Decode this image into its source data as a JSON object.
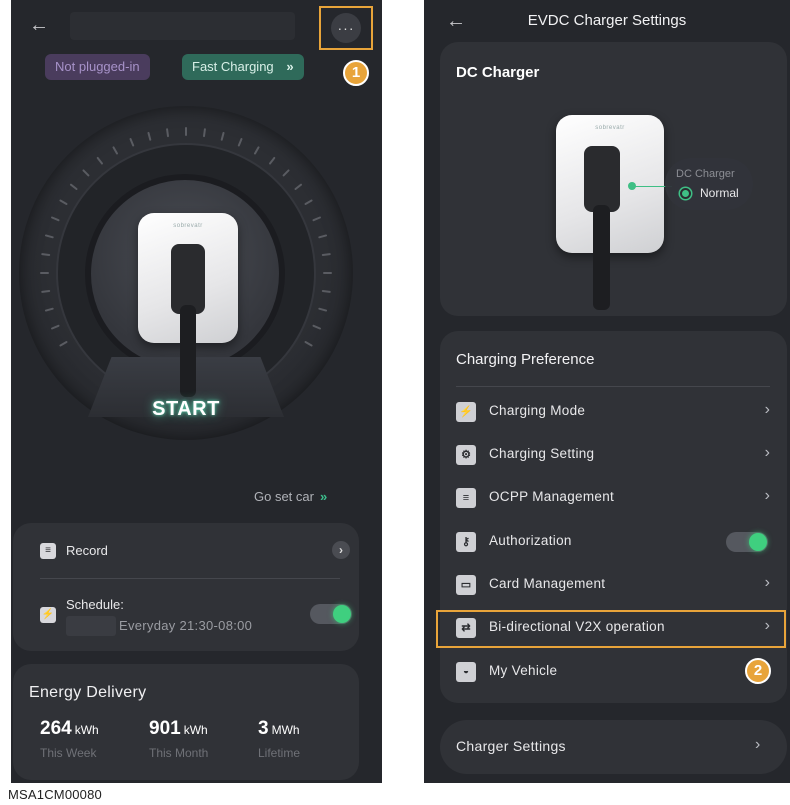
{
  "left_screen": {
    "more_button_glyph": "···",
    "callout_1": "1",
    "status_badge": "Not plugged-in",
    "mode_badge": "Fast Charging",
    "mode_badge_chevron": "»",
    "start_label": "START",
    "charger_brand": "sobrevatr",
    "go_set_car": "Go set car",
    "go_set_car_chevron": "»",
    "record_label": "Record",
    "schedule_label": "Schedule:",
    "schedule_time": "Everyday  21:30-08:00",
    "schedule_toggle_on": true,
    "energy_title": "Energy Delivery",
    "stats": [
      {
        "value": "264",
        "unit": "kWh",
        "label": "This Week"
      },
      {
        "value": "901",
        "unit": "kWh",
        "label": "This Month"
      },
      {
        "value": "3",
        "unit": "MWh",
        "label": "Lifetime"
      }
    ]
  },
  "right_screen": {
    "header_title": "EVDC Charger Settings",
    "dc_title": "DC Charger",
    "charger_brand": "sobrevatr",
    "dc_status_name": "DC Charger",
    "dc_status_value": "Normal",
    "pref_title": "Charging Preference",
    "menu": [
      {
        "label": "Charging Mode",
        "icon": "charging-mode-icon",
        "glyph": "⚡"
      },
      {
        "label": "Charging Setting",
        "icon": "charging-setting-icon",
        "glyph": "⚙"
      },
      {
        "label": "OCPP Management",
        "icon": "ocpp-icon",
        "glyph": "≡"
      },
      {
        "label": "Authorization",
        "icon": "key-icon",
        "glyph": "⚷"
      },
      {
        "label": "Card Management",
        "icon": "card-icon",
        "glyph": "▭"
      },
      {
        "label": "Bi-directional V2X operation",
        "icon": "v2x-icon",
        "glyph": "⇄"
      },
      {
        "label": "My Vehicle",
        "icon": "car-icon",
        "glyph": "🚗"
      }
    ],
    "authorization_toggle_on": true,
    "callout_2": "2",
    "charger_settings_label": "Charger Settings"
  },
  "caption": "MSA1CM00080",
  "colors": {
    "accent_callout": "#e8a43a",
    "toggle_on": "#3fcf7f",
    "teal": "#3cbf8d",
    "status_purple": "#4a3c5d"
  }
}
